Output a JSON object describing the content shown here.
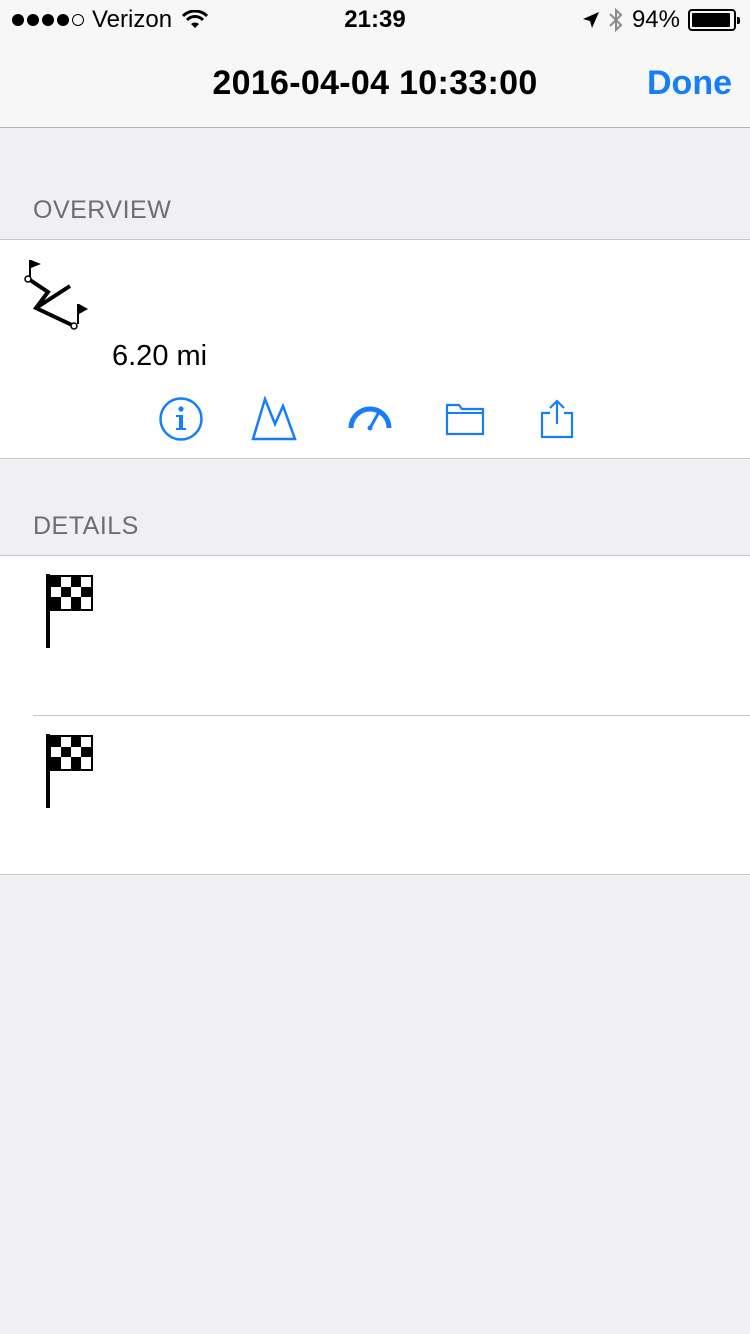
{
  "status_bar": {
    "carrier": "Verizon",
    "time": "21:39",
    "battery": "94%",
    "signal_icon": "signal-dots-icon",
    "wifi_icon": "wifi-icon",
    "location_icon": "location-arrow-icon",
    "bluetooth_icon": "bluetooth-icon",
    "battery_level": 0.94
  },
  "nav": {
    "title": "2016-04-04 10:33:00",
    "done_label": "Done",
    "accent": "#157efb"
  },
  "overview": {
    "header": "OVERVIEW",
    "route_icon": "route-flags-icon",
    "distance": "6.20 mi",
    "actions": [
      {
        "name": "info-icon"
      },
      {
        "name": "elevation-icon"
      },
      {
        "name": "speedometer-icon"
      },
      {
        "name": "folder-icon"
      },
      {
        "name": "share-icon"
      }
    ]
  },
  "details": {
    "header": "DETAILS",
    "rows": [
      {
        "icon": "checkered-flag-icon"
      },
      {
        "icon": "checkered-flag-icon"
      }
    ]
  }
}
